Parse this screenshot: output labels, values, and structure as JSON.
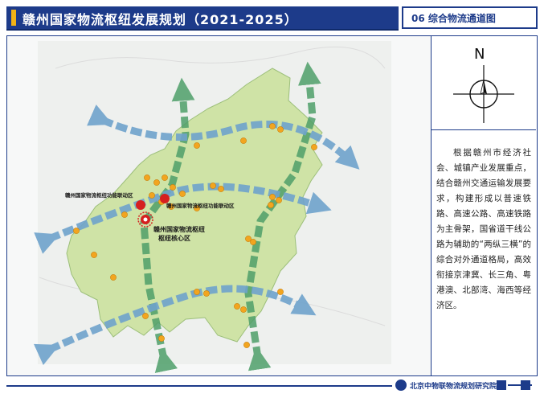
{
  "header": {
    "title": "赣州国家物流枢纽发展规划（2021-2025）",
    "section": "06 综合物流通道图"
  },
  "compass": {
    "north_label": "N"
  },
  "side_panel": {
    "description": "根据赣州市经济社会、城镇产业发展重点，结合赣州交通运输发展要求，构建形成以普速铁路、高速公路、高速铁路为主骨架，国省道干线公路为辅助的“两纵三横”的综合对外通道格局，高效衔接京津冀、长三角、粤港澳、北部湾、海西等经济区。"
  },
  "map": {
    "labels": {
      "left_node": "赣州国家物流枢纽功能联动区",
      "right_node": "赣州国家物流枢纽功能联动区",
      "core_line1": "赣州国家物流枢纽",
      "core_line2": "枢纽核心区"
    },
    "colors": {
      "vertical_corridor": "#4f9f6a",
      "horizontal_corridor": "#6fa3cc",
      "region_fill": "#cfe3a6",
      "node": "#f2a51f",
      "hub": "#d62020"
    }
  },
  "footer": {
    "org": "北京中物联物流规划研究院"
  }
}
